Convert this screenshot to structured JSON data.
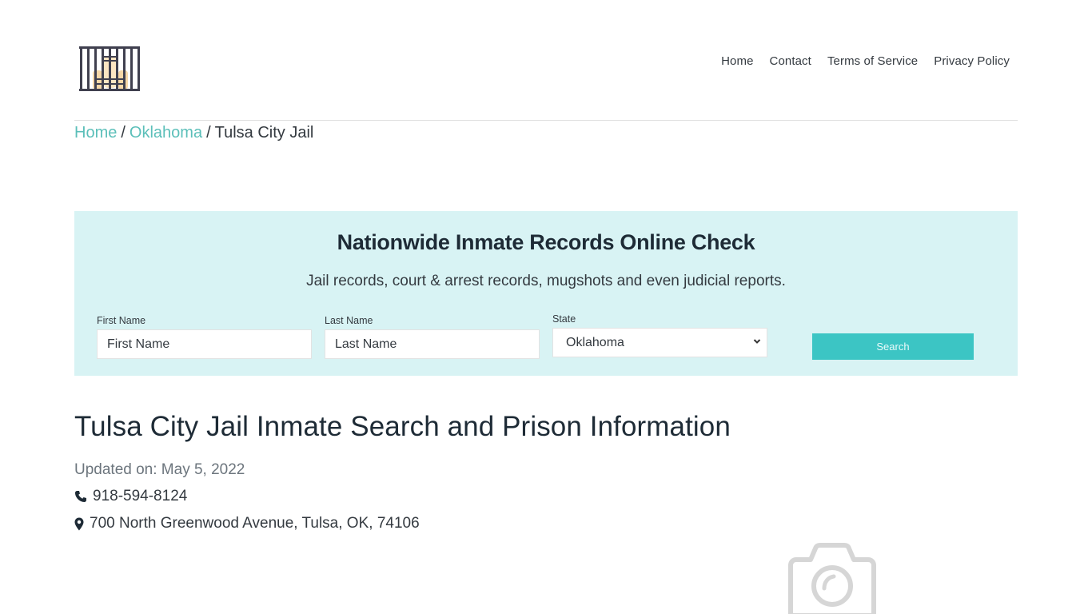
{
  "header": {
    "logo_icon": "jail-bars-logo-icon",
    "nav": [
      {
        "label": "Home"
      },
      {
        "label": "Contact"
      },
      {
        "label": "Terms of Service"
      },
      {
        "label": "Privacy Policy"
      }
    ]
  },
  "breadcrumb": {
    "items": [
      {
        "label": "Home",
        "link": true
      },
      {
        "label": "Oklahoma",
        "link": true
      },
      {
        "label": "Tulsa City Jail",
        "link": false
      }
    ],
    "separator": "/"
  },
  "search_panel": {
    "title": "Nationwide Inmate Records Online Check",
    "subtitle": "Jail records, court & arrest records, mugshots and even judicial reports.",
    "first_name": {
      "label": "First Name",
      "placeholder": "First Name",
      "value": ""
    },
    "last_name": {
      "label": "Last Name",
      "placeholder": "Last Name",
      "value": ""
    },
    "state": {
      "label": "State",
      "selected": "Oklahoma"
    },
    "search_button": "Search",
    "background_color": "#d8f3f4",
    "button_color": "#3cc5c4"
  },
  "main": {
    "title": "Tulsa City Jail Inmate Search and Prison Information",
    "updated": "Updated on: May 5, 2022",
    "phone": "918-594-8124",
    "phone_icon": "phone-icon",
    "address": "700 North Greenwood Avenue, Tulsa, OK, 74106",
    "address_icon": "map-marker-icon",
    "image_placeholder_icon": "camera-icon"
  },
  "colors": {
    "accent_link": "#5bbfb9",
    "heading": "#1e2b36"
  }
}
